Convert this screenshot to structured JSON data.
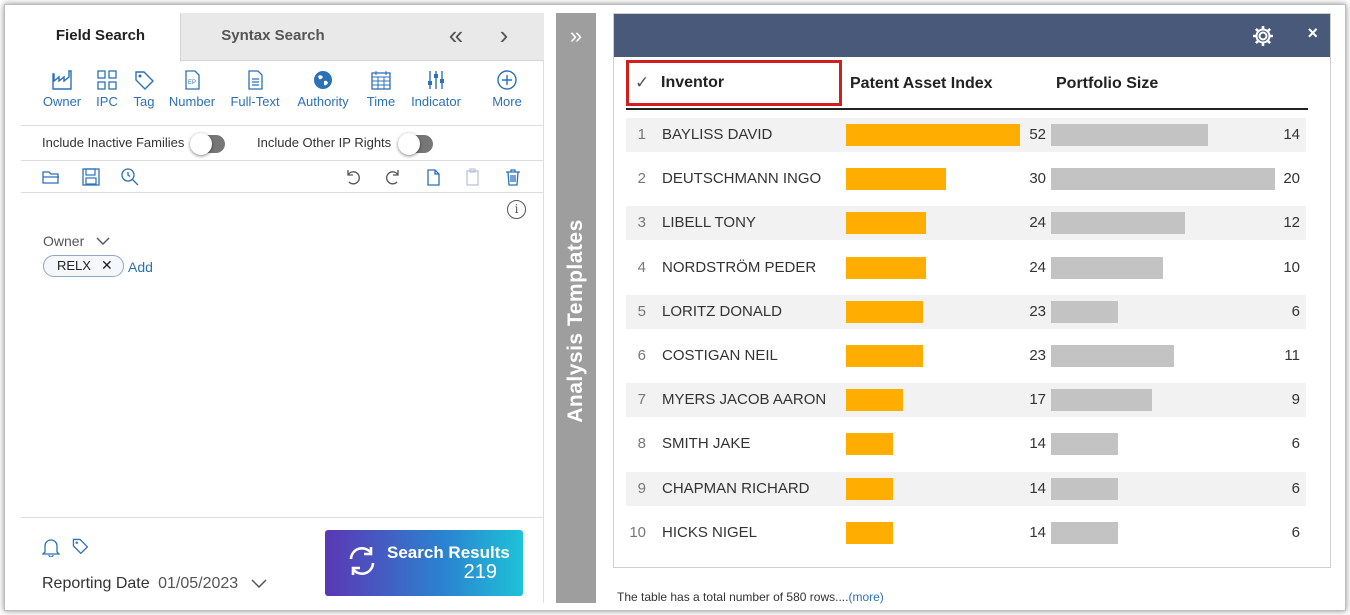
{
  "tabs": [
    {
      "label": "Field Search",
      "active": true
    },
    {
      "label": "Syntax Search",
      "active": false
    }
  ],
  "fields": [
    {
      "label": "Owner",
      "icon": "factory-icon"
    },
    {
      "label": "IPC",
      "icon": "grid-icon"
    },
    {
      "label": "Tag",
      "icon": "tag-icon"
    },
    {
      "label": "Number",
      "icon": "ep-document-icon"
    },
    {
      "label": "Full-Text",
      "icon": "document-icon"
    },
    {
      "label": "Authority",
      "icon": "globe-icon"
    },
    {
      "label": "Time",
      "icon": "calendar-icon"
    },
    {
      "label": "Indicator",
      "icon": "sliders-icon"
    },
    {
      "label": "More",
      "icon": "plus-circle-icon"
    }
  ],
  "toggles": [
    {
      "label": "Include Inactive Families",
      "on": false
    },
    {
      "label": "Include Other IP Rights",
      "on": false
    }
  ],
  "filter": {
    "label": "Owner",
    "chip": "RELX",
    "add_label": "Add"
  },
  "bottom": {
    "reporting_label": "Reporting Date",
    "reporting_date": "01/05/2023",
    "search_title": "Search Results",
    "search_count": "219"
  },
  "sidebar": {
    "label": "Analysis Templates"
  },
  "table": {
    "headers": [
      "Inventor",
      "Patent Asset Index",
      "Portfolio Size"
    ],
    "rows": [
      {
        "rank": "1",
        "name": "BAYLISS DAVID",
        "pai": 52,
        "pai_text": "52",
        "size": 14,
        "size_text": "14"
      },
      {
        "rank": "2",
        "name": "DEUTSCHMANN INGO",
        "pai": 30,
        "pai_text": "30",
        "size": 20,
        "size_text": "20"
      },
      {
        "rank": "3",
        "name": "LIBELL TONY",
        "pai": 24,
        "pai_text": "24",
        "size": 12,
        "size_text": "12"
      },
      {
        "rank": "4",
        "name": "NORDSTRÖM PEDER",
        "pai": 24,
        "pai_text": "24",
        "size": 10,
        "size_text": "10"
      },
      {
        "rank": "5",
        "name": "LORITZ DONALD",
        "pai": 23,
        "pai_text": "23",
        "size": 6,
        "size_text": "6"
      },
      {
        "rank": "6",
        "name": "COSTIGAN NEIL",
        "pai": 23,
        "pai_text": "23",
        "size": 11,
        "size_text": "11"
      },
      {
        "rank": "7",
        "name": "MYERS JACOB AARON",
        "pai": 17,
        "pai_text": "17",
        "size": 9,
        "size_text": "9"
      },
      {
        "rank": "8",
        "name": "SMITH JAKE",
        "pai": 14,
        "pai_text": "14",
        "size": 6,
        "size_text": "6"
      },
      {
        "rank": "9",
        "name": "CHAPMAN RICHARD",
        "pai": 14,
        "pai_text": "14",
        "size": 6,
        "size_text": "6"
      },
      {
        "rank": "10",
        "name": "HICKS NIGEL",
        "pai": 14,
        "pai_text": "14",
        "size": 6,
        "size_text": "6"
      }
    ],
    "footnote": "The table has a total number of 580 rows....",
    "more_label": "(more)"
  },
  "colors": {
    "accent": "#2c70b6",
    "header_bar": "#48597a",
    "pai_bar": "#ffae00",
    "size_bar": "#c3c3c3",
    "highlight": "#d11e1e"
  }
}
